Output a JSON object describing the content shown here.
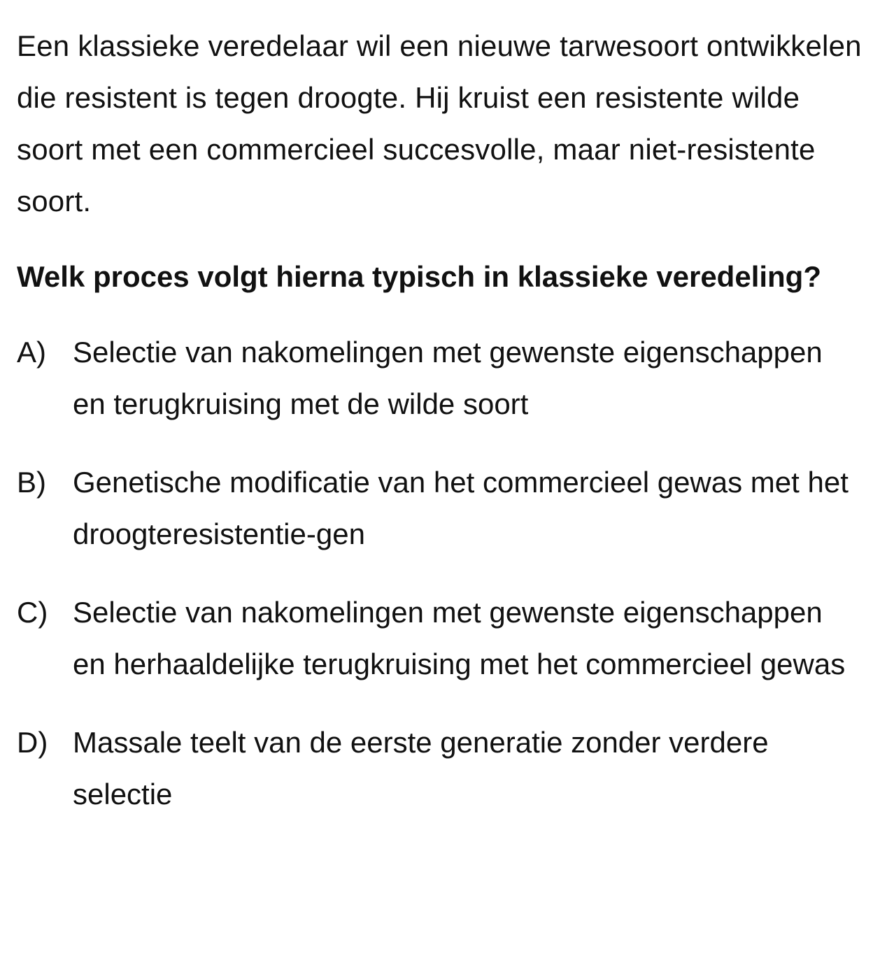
{
  "question": {
    "intro": "Een klassieke veredelaar wil een nieuwe tarwesoort ontwikkelen die resistent is tegen droogte. Hij kruist een resistente wilde soort met een commercieel succesvolle, maar niet-resistente soort.",
    "prompt": "Welk proces volgt hierna typisch in klassieke veredeling?"
  },
  "options": [
    {
      "letter": "A)",
      "text": "Selectie van nakomelingen met gewenste eigenschappen en terugkruising met de wilde soort"
    },
    {
      "letter": "B)",
      "text": "Genetische modificatie van het commercieel gewas met het droogteresistentie-gen"
    },
    {
      "letter": "C)",
      "text": "Selectie van nakomelingen met gewenste eigenschappen en herhaaldelijke terugkruising met het commercieel gewas"
    },
    {
      "letter": "D)",
      "text": "Massale teelt van de eerste generatie zonder verdere selectie"
    }
  ]
}
